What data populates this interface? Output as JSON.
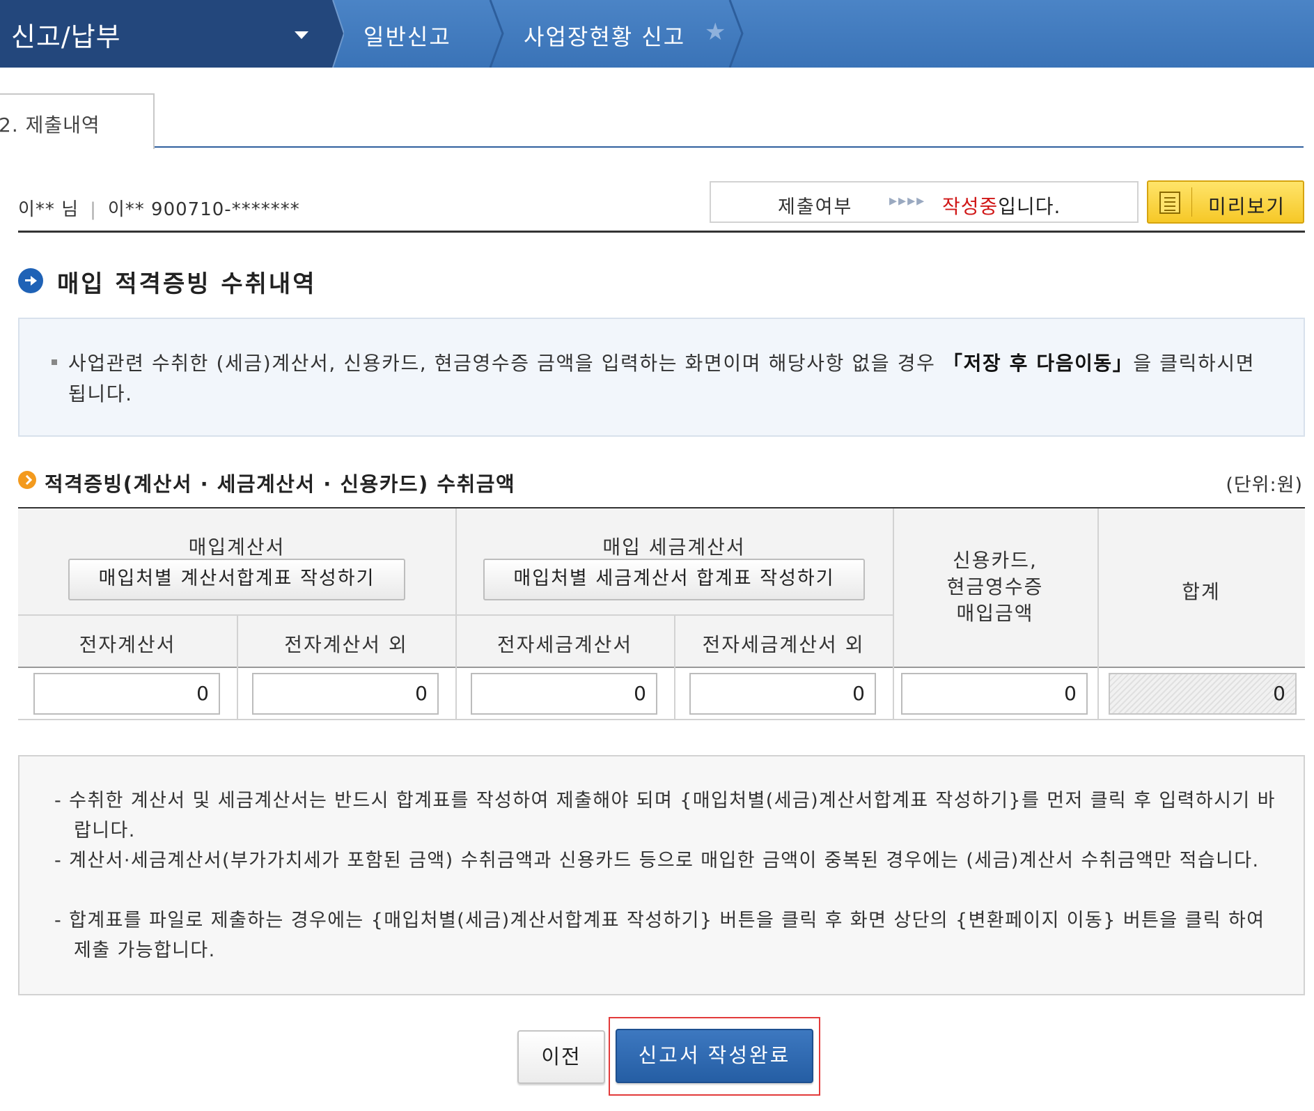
{
  "nav": {
    "main_title": "신고/납부",
    "items": [
      "일반신고",
      "사업장현황 신고"
    ]
  },
  "tab": {
    "label": "2. 제출내역"
  },
  "user": {
    "name": "이** 님",
    "id": "이** 900710-*******"
  },
  "status": {
    "label": "제출여부",
    "arrows": "▸▸▸▸",
    "value_highlight": "작성중",
    "value_rest": "입니다.",
    "highlight_color": "#d01717"
  },
  "preview_button": {
    "label": "미리보기",
    "icon": "document-icon"
  },
  "section": {
    "title": "매입 적격증빙 수취내역",
    "info_text_1": "사업관련 수취한 (세금)계산서, 신용카드, 현금영수증 금액을 입력하는 화면이며 해당사항 없을 경우 ",
    "info_text_bold": "「저장 후 다음이동」",
    "info_text_2": "을 클릭하시면 됩니다."
  },
  "subsection": {
    "title": "적격증빙(계산서 · 세금계산서 · 신용카드) 수취금액",
    "unit": "(단위:원)"
  },
  "table": {
    "group_1": {
      "title": "매입계산서",
      "button": "매입처별 계산서합계표 작성하기"
    },
    "group_2": {
      "title": "매입 세금계산서",
      "button": "매입처별 세금계산서 합계표 작성하기"
    },
    "card_header": [
      "신용카드,",
      "현금영수증",
      "매입금액"
    ],
    "total_header": "합계",
    "sub_headers": [
      "전자계산서",
      "전자계산서 외",
      "전자세금계산서",
      "전자세금계산서 외"
    ],
    "values": [
      "0",
      "0",
      "0",
      "0",
      "0",
      "0"
    ]
  },
  "notes": [
    "- 수취한 계산서 및 세금계산서는 반드시 합계표를 작성하여 제출해야 되며 {매입처별(세금)계산서합계표 작성하기}를 먼저 클릭 후 입력하시기 바랍니다.",
    "- 계산서·세금계산서(부가가치세가 포함된 금액) 수취금액과 신용카드 등으로 매입한 금액이 중복된 경우에는 (세금)계산서 수취금액만 적습니다.",
    "- 합계표를 파일로 제출하는 경우에는 {매입처별(세금)계산서합계표 작성하기} 버튼을 클릭 후 화면 상단의 {변환페이지 이동} 버튼을 클릭 하여 제출 가능합니다."
  ],
  "buttons": {
    "prev": "이전",
    "done": "신고서 작성완료"
  }
}
